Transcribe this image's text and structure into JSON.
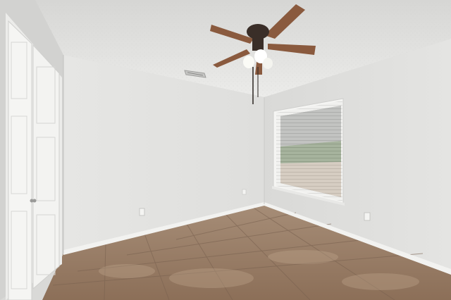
{
  "scene": {
    "description_tag": "photo",
    "colors": {
      "ceiling": "#e4e4e2",
      "wall_back": "#e3e3e1",
      "wall_right": "#dadad8",
      "wall_left": "#cfcfcd",
      "baseboard": "#f2f2f0",
      "floor_base": "#9a7f68",
      "floor_grout": "#7d6553",
      "door": "#f3f3f1",
      "fan_blade": "#8a5a3e",
      "fan_body": "#3a2e28",
      "window_frame": "#f5f5f3",
      "blind": "#f0f0ee"
    },
    "icons": [
      "ceiling-fan-icon",
      "air-vent-icon",
      "outlet-icon"
    ]
  }
}
